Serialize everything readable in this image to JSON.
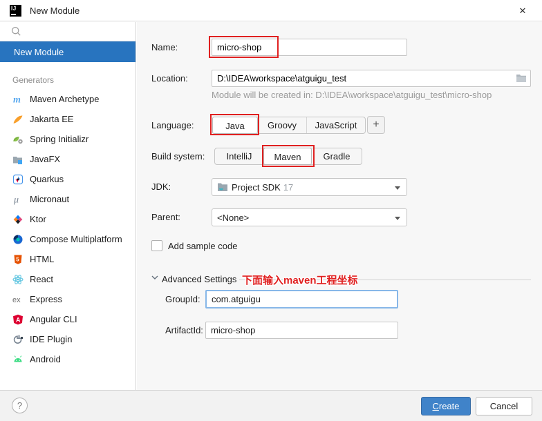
{
  "window": {
    "title": "New Module",
    "logo_text": "IJ",
    "close_glyph": "✕"
  },
  "sidebar": {
    "selected_item": "New Module",
    "section_label": "Generators",
    "items": [
      {
        "label": "Maven Archetype",
        "icon": "maven-archetype-icon"
      },
      {
        "label": "Jakarta EE",
        "icon": "jakarta-ee-icon"
      },
      {
        "label": "Spring Initializr",
        "icon": "spring-initializr-icon"
      },
      {
        "label": "JavaFX",
        "icon": "javafx-icon"
      },
      {
        "label": "Quarkus",
        "icon": "quarkus-icon"
      },
      {
        "label": "Micronaut",
        "icon": "micronaut-icon"
      },
      {
        "label": "Ktor",
        "icon": "ktor-icon"
      },
      {
        "label": "Compose Multiplatform",
        "icon": "compose-multiplatform-icon"
      },
      {
        "label": "HTML",
        "icon": "html-icon"
      },
      {
        "label": "React",
        "icon": "react-icon"
      },
      {
        "label": "Express",
        "icon": "express-icon"
      },
      {
        "label": "Angular CLI",
        "icon": "angular-cli-icon"
      },
      {
        "label": "IDE Plugin",
        "icon": "ide-plugin-icon"
      },
      {
        "label": "Android",
        "icon": "android-icon"
      }
    ]
  },
  "form": {
    "name": {
      "label": "Name:",
      "value": "micro-shop"
    },
    "location": {
      "label": "Location:",
      "value": "D:\\IDEA\\workspace\\atguigu_test",
      "hint": "Module will be created in: D:\\IDEA\\workspace\\atguigu_test\\micro-shop"
    },
    "language": {
      "label": "Language:",
      "options": [
        "Java",
        "Groovy",
        "JavaScript"
      ],
      "selected": "Java",
      "add_button": "+"
    },
    "build_system": {
      "label": "Build system:",
      "options": [
        "IntelliJ",
        "Maven",
        "Gradle"
      ],
      "selected": "Maven"
    },
    "jdk": {
      "label": "JDK:",
      "value": "Project SDK",
      "version": "17"
    },
    "parent": {
      "label": "Parent:",
      "value": "<None>"
    },
    "add_sample_code": {
      "label": "Add sample code",
      "checked": false
    },
    "advanced": {
      "label": "Advanced Settings",
      "annotation": "下面输入maven工程坐标",
      "group_id": {
        "label": "GroupId:",
        "value": "com.atguigu"
      },
      "artifact_id": {
        "label": "ArtifactId:",
        "value": "micro-shop"
      }
    }
  },
  "footer": {
    "help": "?",
    "create_initial": "C",
    "create_rest": "reate",
    "cancel_label": "Cancel"
  },
  "colors": {
    "sidebar_selected": "#2874bf",
    "primary_button": "#4083c9",
    "annotation_red": "#e02020",
    "focus_border": "#87b7e8"
  }
}
